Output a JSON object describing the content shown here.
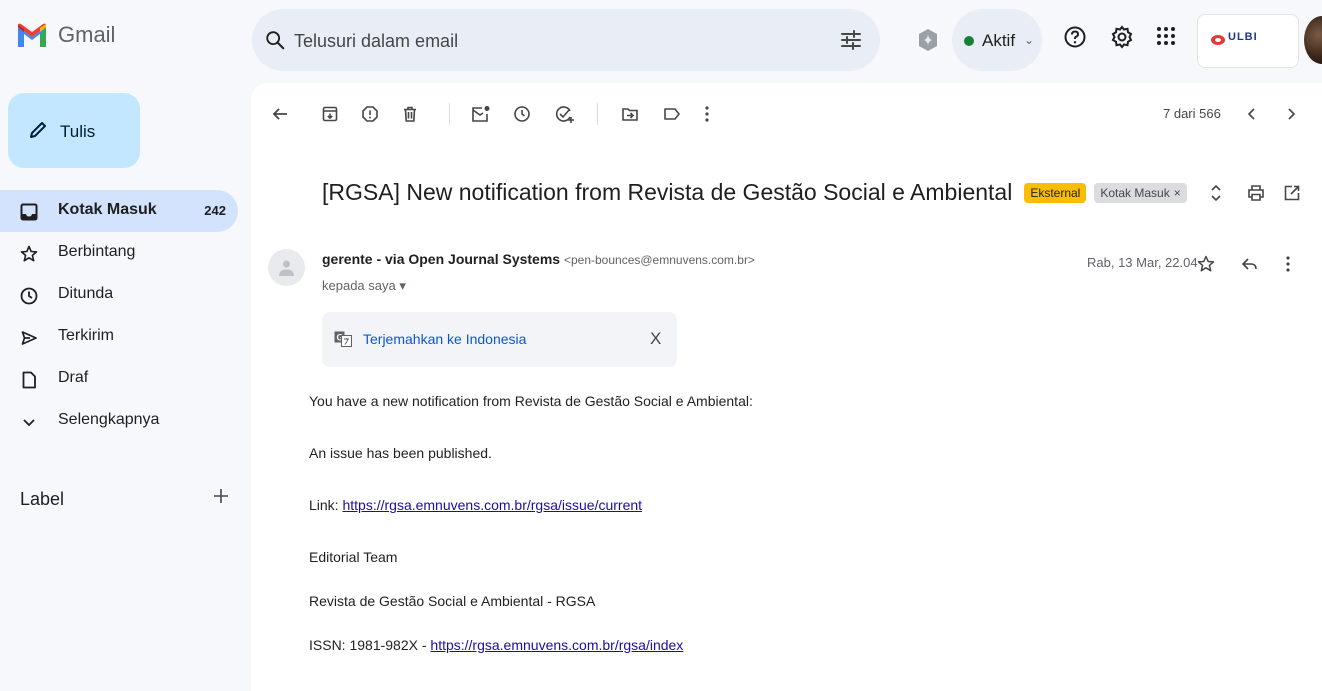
{
  "app": {
    "name": "Gmail",
    "brand_colors": {
      "red": "#ea4335",
      "blue": "#4285f4",
      "green": "#34a853",
      "yellow": "#fbbc04"
    }
  },
  "search": {
    "placeholder": "Telusuri dalam email",
    "icon": "search-icon",
    "options_icon": "tune-icon"
  },
  "header": {
    "status_label": "Aktif",
    "status_color": "#188038",
    "icons": [
      "gemini-icon",
      "help-icon",
      "settings-icon",
      "apps-grid-icon"
    ],
    "org_logo_text": "ULBI"
  },
  "sidebar": {
    "compose_label": "Tulis",
    "items": [
      {
        "label": "Kotak Masuk",
        "count": "242",
        "icon": "inbox-icon",
        "active": true
      },
      {
        "label": "Berbintang",
        "icon": "star-icon"
      },
      {
        "label": "Ditunda",
        "icon": "clock-icon"
      },
      {
        "label": "Terkirim",
        "icon": "send-icon"
      },
      {
        "label": "Draf",
        "icon": "draft-icon"
      },
      {
        "label": "Selengkapnya",
        "icon": "chevron-down-icon"
      }
    ],
    "labels_heading": "Label"
  },
  "toolbar": {
    "icons": [
      "back-icon",
      "archive-icon",
      "report-spam-icon",
      "delete-icon",
      "mark-unread-icon",
      "snooze-icon",
      "add-task-icon",
      "move-to-icon",
      "label-icon",
      "more-icon"
    ],
    "pager": "7 dari 566"
  },
  "email": {
    "subject": "[RGSA] New notification from Revista de Gestão Social e Ambiental",
    "chips": {
      "external": "Eksternal",
      "inbox": "Kotak Masuk",
      "inbox_remove": "×"
    },
    "sender_name": "gerente - via Open Journal Systems",
    "sender_email": "<pen-bounces@emnuvens.com.br>",
    "to": "kepada saya",
    "to_arrow": "▾",
    "date": "Rab, 13 Mar, 22.04",
    "translate_label": "Terjemahkan ke Indonesia",
    "translate_close": "X",
    "body": {
      "line1": "You have a new notification from Revista de Gestão Social e Ambiental:",
      "line2": "An issue has been published.",
      "link_prefix": "Link: ",
      "link": "https://rgsa.emnuvens.com.br/rgsa/issue/current",
      "line4": "Editorial Team",
      "line5": "Revista de Gestão Social e Ambiental - RGSA",
      "issn_prefix": "ISSN: 1981-982X - ",
      "issn_link": "https://rgsa.emnuvens.com.br/rgsa/index"
    }
  }
}
